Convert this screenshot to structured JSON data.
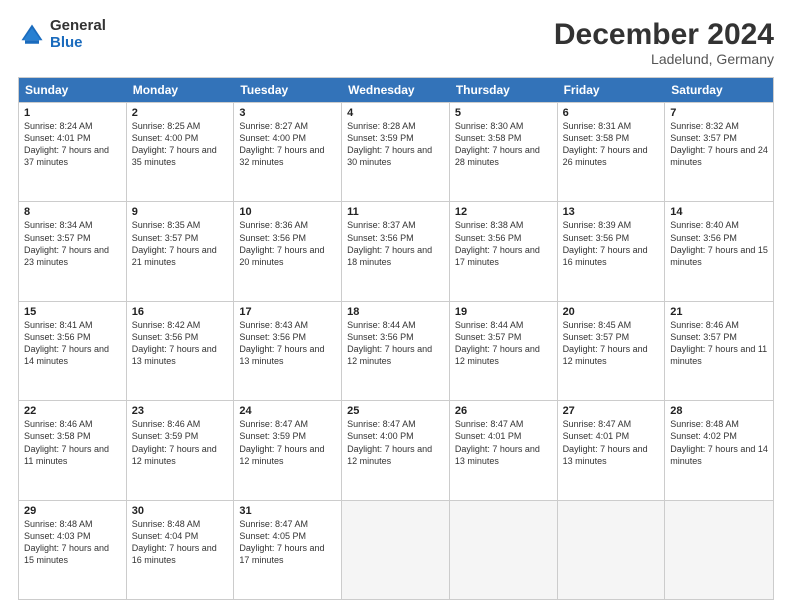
{
  "logo": {
    "general": "General",
    "blue": "Blue"
  },
  "title": "December 2024",
  "subtitle": "Ladelund, Germany",
  "days": [
    "Sunday",
    "Monday",
    "Tuesday",
    "Wednesday",
    "Thursday",
    "Friday",
    "Saturday"
  ],
  "weeks": [
    [
      {
        "day": 1,
        "rise": "8:24 AM",
        "set": "4:01 PM",
        "daylight": "7 hours and 37 minutes."
      },
      {
        "day": 2,
        "rise": "8:25 AM",
        "set": "4:00 PM",
        "daylight": "7 hours and 35 minutes."
      },
      {
        "day": 3,
        "rise": "8:27 AM",
        "set": "4:00 PM",
        "daylight": "7 hours and 32 minutes."
      },
      {
        "day": 4,
        "rise": "8:28 AM",
        "set": "3:59 PM",
        "daylight": "7 hours and 30 minutes."
      },
      {
        "day": 5,
        "rise": "8:30 AM",
        "set": "3:58 PM",
        "daylight": "7 hours and 28 minutes."
      },
      {
        "day": 6,
        "rise": "8:31 AM",
        "set": "3:58 PM",
        "daylight": "7 hours and 26 minutes."
      },
      {
        "day": 7,
        "rise": "8:32 AM",
        "set": "3:57 PM",
        "daylight": "7 hours and 24 minutes."
      }
    ],
    [
      {
        "day": 8,
        "rise": "8:34 AM",
        "set": "3:57 PM",
        "daylight": "7 hours and 23 minutes."
      },
      {
        "day": 9,
        "rise": "8:35 AM",
        "set": "3:57 PM",
        "daylight": "7 hours and 21 minutes."
      },
      {
        "day": 10,
        "rise": "8:36 AM",
        "set": "3:56 PM",
        "daylight": "7 hours and 20 minutes."
      },
      {
        "day": 11,
        "rise": "8:37 AM",
        "set": "3:56 PM",
        "daylight": "7 hours and 18 minutes."
      },
      {
        "day": 12,
        "rise": "8:38 AM",
        "set": "3:56 PM",
        "daylight": "7 hours and 17 minutes."
      },
      {
        "day": 13,
        "rise": "8:39 AM",
        "set": "3:56 PM",
        "daylight": "7 hours and 16 minutes."
      },
      {
        "day": 14,
        "rise": "8:40 AM",
        "set": "3:56 PM",
        "daylight": "7 hours and 15 minutes."
      }
    ],
    [
      {
        "day": 15,
        "rise": "8:41 AM",
        "set": "3:56 PM",
        "daylight": "7 hours and 14 minutes."
      },
      {
        "day": 16,
        "rise": "8:42 AM",
        "set": "3:56 PM",
        "daylight": "7 hours and 13 minutes."
      },
      {
        "day": 17,
        "rise": "8:43 AM",
        "set": "3:56 PM",
        "daylight": "7 hours and 13 minutes."
      },
      {
        "day": 18,
        "rise": "8:44 AM",
        "set": "3:56 PM",
        "daylight": "7 hours and 12 minutes."
      },
      {
        "day": 19,
        "rise": "8:44 AM",
        "set": "3:57 PM",
        "daylight": "7 hours and 12 minutes."
      },
      {
        "day": 20,
        "rise": "8:45 AM",
        "set": "3:57 PM",
        "daylight": "7 hours and 12 minutes."
      },
      {
        "day": 21,
        "rise": "8:46 AM",
        "set": "3:57 PM",
        "daylight": "7 hours and 11 minutes."
      }
    ],
    [
      {
        "day": 22,
        "rise": "8:46 AM",
        "set": "3:58 PM",
        "daylight": "7 hours and 11 minutes."
      },
      {
        "day": 23,
        "rise": "8:46 AM",
        "set": "3:59 PM",
        "daylight": "7 hours and 12 minutes."
      },
      {
        "day": 24,
        "rise": "8:47 AM",
        "set": "3:59 PM",
        "daylight": "7 hours and 12 minutes."
      },
      {
        "day": 25,
        "rise": "8:47 AM",
        "set": "4:00 PM",
        "daylight": "7 hours and 12 minutes."
      },
      {
        "day": 26,
        "rise": "8:47 AM",
        "set": "4:01 PM",
        "daylight": "7 hours and 13 minutes."
      },
      {
        "day": 27,
        "rise": "8:47 AM",
        "set": "4:01 PM",
        "daylight": "7 hours and 13 minutes."
      },
      {
        "day": 28,
        "rise": "8:48 AM",
        "set": "4:02 PM",
        "daylight": "7 hours and 14 minutes."
      }
    ],
    [
      {
        "day": 29,
        "rise": "8:48 AM",
        "set": "4:03 PM",
        "daylight": "7 hours and 15 minutes."
      },
      {
        "day": 30,
        "rise": "8:48 AM",
        "set": "4:04 PM",
        "daylight": "7 hours and 16 minutes."
      },
      {
        "day": 31,
        "rise": "8:47 AM",
        "set": "4:05 PM",
        "daylight": "7 hours and 17 minutes."
      },
      null,
      null,
      null,
      null
    ]
  ]
}
